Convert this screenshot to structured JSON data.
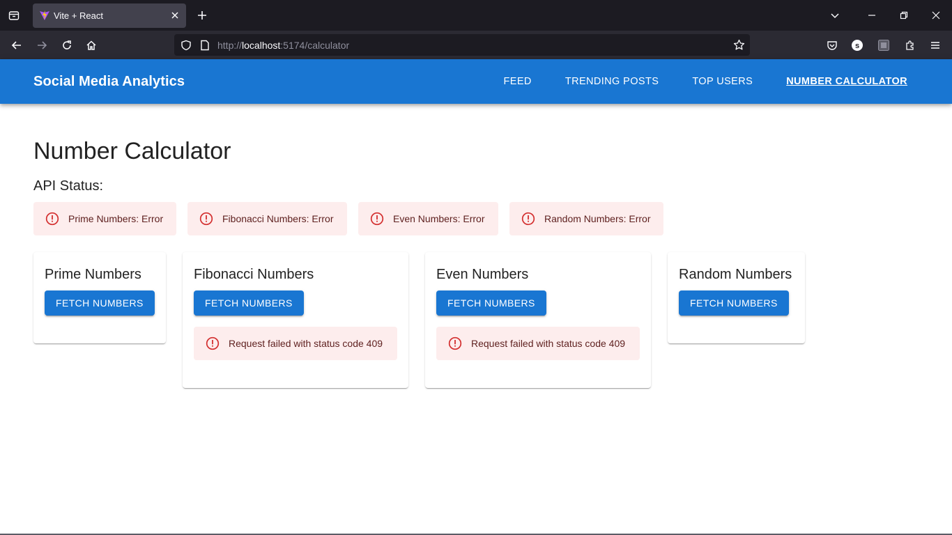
{
  "browser": {
    "tab_title": "Vite + React",
    "url_prefix": "http://",
    "url_host": "localhost",
    "url_rest": ":5174/calculator"
  },
  "app": {
    "brand": "Social Media Analytics",
    "nav": [
      {
        "label": "FEED",
        "active": false
      },
      {
        "label": "TRENDING POSTS",
        "active": false
      },
      {
        "label": "TOP USERS",
        "active": false
      },
      {
        "label": "NUMBER CALCULATOR",
        "active": true
      }
    ]
  },
  "page": {
    "title": "Number Calculator",
    "api_status_label": "API Status:",
    "status_alerts": [
      {
        "text": "Prime Numbers: Error"
      },
      {
        "text": "Fibonacci Numbers: Error"
      },
      {
        "text": "Even Numbers: Error"
      },
      {
        "text": "Random Numbers: Error"
      }
    ],
    "cards": [
      {
        "title": "Prime Numbers",
        "button": "FETCH NUMBERS",
        "error": null
      },
      {
        "title": "Fibonacci Numbers",
        "button": "FETCH NUMBERS",
        "error": "Request failed with status code 409"
      },
      {
        "title": "Even Numbers",
        "button": "FETCH NUMBERS",
        "error": "Request failed with status code 409"
      },
      {
        "title": "Random Numbers",
        "button": "FETCH NUMBERS",
        "error": null
      }
    ]
  },
  "colors": {
    "primary": "#1976d2",
    "error_bg": "#fdeded",
    "error_text": "#5f2120",
    "error_icon": "#d32f2f"
  }
}
